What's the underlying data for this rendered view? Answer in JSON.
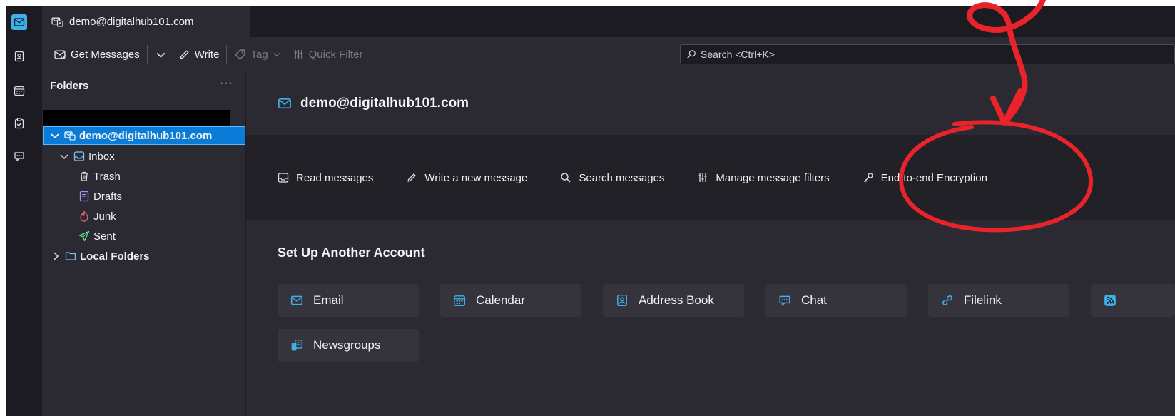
{
  "tab": {
    "title": "demo@digitalhub101.com"
  },
  "toolbar": {
    "get_messages": "Get Messages",
    "write": "Write",
    "tag": "Tag",
    "quick_filter": "Quick Filter",
    "search_placeholder": "Search <Ctrl+K>"
  },
  "folders": {
    "header": "Folders",
    "more": "···",
    "account": "demo@digitalhub101.com",
    "inbox": "Inbox",
    "trash": "Trash",
    "drafts": "Drafts",
    "junk": "Junk",
    "sent": "Sent",
    "local": "Local Folders"
  },
  "main": {
    "account_title": "demo@digitalhub101.com",
    "actions": {
      "read": "Read messages",
      "write": "Write a new message",
      "search": "Search messages",
      "filters": "Manage message filters",
      "e2e": "End-to-end Encryption"
    },
    "setup_title": "Set Up Another Account",
    "cards": {
      "email": "Email",
      "calendar": "Calendar",
      "address_book": "Address Book",
      "chat": "Chat",
      "filelink": "Filelink",
      "newsgroups": "Newsgroups"
    }
  },
  "colors": {
    "accent": "#3fb1e8",
    "selection": "#0a7bd6",
    "annotation": "#e8232a"
  }
}
